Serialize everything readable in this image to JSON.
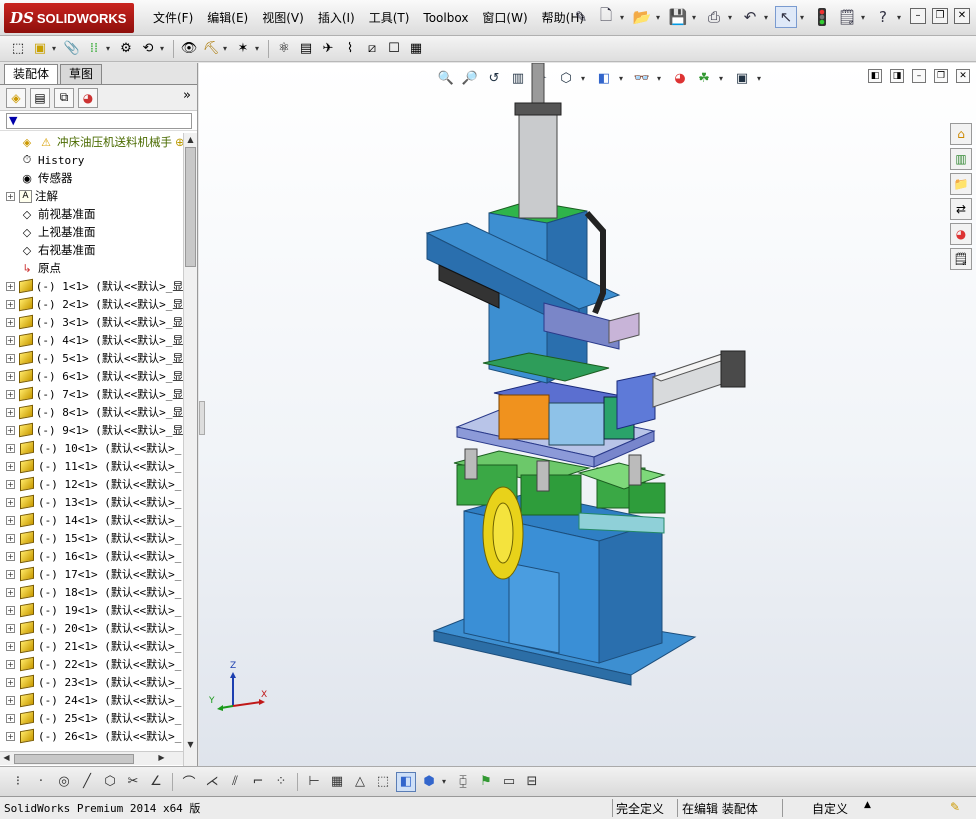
{
  "app": {
    "logo_ds": "DS",
    "logo_name": "SOLIDWORKS"
  },
  "menu": [
    "文件(F)",
    "编辑(E)",
    "视图(V)",
    "插入(I)",
    "工具(T)",
    "Toolbox",
    "窗口(W)",
    "帮助(H)"
  ],
  "panel": {
    "tabs": [
      "装配体",
      "草图"
    ],
    "filter_icon": "filter-icon",
    "root_label": "冲床油压机送料机械手",
    "fixed_items": [
      {
        "label": "History",
        "icon": "history-icon",
        "expandable": false
      },
      {
        "label": "传感器",
        "icon": "sensor-icon",
        "expandable": false
      },
      {
        "label": "注解",
        "icon": "annotation-icon",
        "expandable": true
      },
      {
        "label": "前视基准面",
        "icon": "plane-icon",
        "expandable": false
      },
      {
        "label": "上视基准面",
        "icon": "plane-icon",
        "expandable": false
      },
      {
        "label": "右视基准面",
        "icon": "plane-icon",
        "expandable": false
      },
      {
        "label": "原点",
        "icon": "origin-icon",
        "expandable": false
      }
    ],
    "parts": [
      "(-) 1<1> (默认<<默认>_显",
      "(-) 2<1> (默认<<默认>_显",
      "(-) 3<1> (默认<<默认>_显",
      "(-) 4<1> (默认<<默认>_显",
      "(-) 5<1> (默认<<默认>_显",
      "(-) 6<1> (默认<<默认>_显",
      "(-) 7<1> (默认<<默认>_显",
      "(-) 8<1> (默认<<默认>_显",
      "(-) 9<1> (默认<<默认>_显",
      "(-) 10<1> (默认<<默认>_",
      "(-) 11<1> (默认<<默认>_",
      "(-) 12<1> (默认<<默认>_",
      "(-) 13<1> (默认<<默认>_",
      "(-) 14<1> (默认<<默认>_",
      "(-) 15<1> (默认<<默认>_",
      "(-) 16<1> (默认<<默认>_",
      "(-) 17<1> (默认<<默认>_",
      "(-) 18<1> (默认<<默认>_",
      "(-) 19<1> (默认<<默认>_",
      "(-) 20<1> (默认<<默认>_",
      "(-) 21<1> (默认<<默认>_",
      "(-) 22<1> (默认<<默认>_",
      "(-) 23<1> (默认<<默认>_",
      "(-) 24<1> (默认<<默认>_",
      "(-) 25<1> (默认<<默认>_",
      "(-) 26<1> (默认<<默认>_"
    ]
  },
  "triad": {
    "x": "X",
    "y": "Y",
    "z": "Z"
  },
  "status": {
    "product": "SolidWorks Premium 2014 x64 版",
    "state": "完全定义",
    "mode": "在编辑 装配体",
    "units": "自定义"
  },
  "colors": {
    "accent_red": "#c9241f",
    "model_blue": "#3d8fd1",
    "model_green": "#3aa845",
    "model_orange": "#f0921e"
  }
}
